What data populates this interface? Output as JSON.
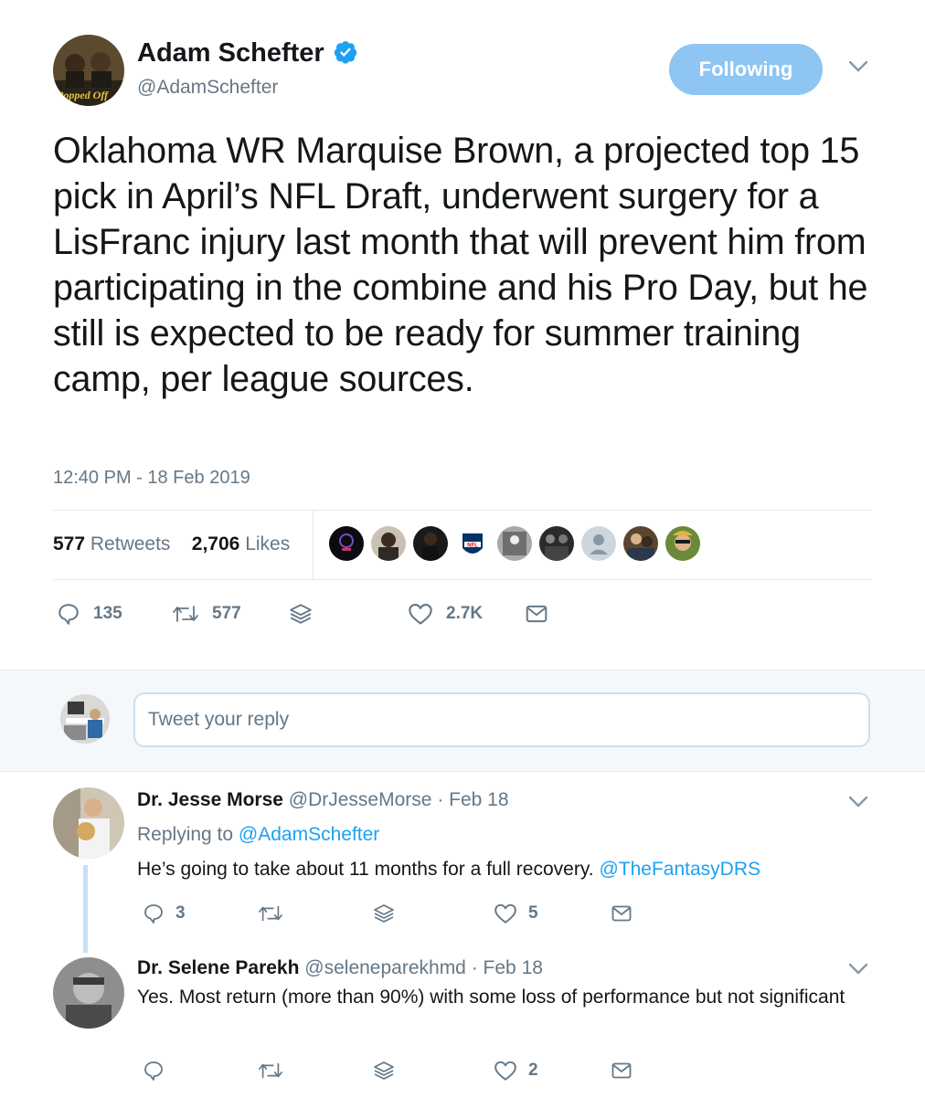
{
  "tweet": {
    "author_name": "Adam Schefter",
    "author_handle": "@AdamSchefter",
    "follow_label": "Following",
    "text": "Oklahoma WR Marquise Brown, a projected top 15 pick in April’s NFL Draft, underwent surgery for a LisFranc injury last month that will prevent him from participating in the combine and his Pro Day, but he still is expected to be ready for summer training camp, per league sources.",
    "timestamp": "12:40 PM - 18 Feb 2019",
    "retweets_count": "577",
    "retweets_label": "Retweets",
    "likes_count": "2,706",
    "likes_label": "Likes",
    "actions": {
      "replies": "135",
      "retweets": "577",
      "likes": "2.7K"
    }
  },
  "composer": {
    "placeholder": "Tweet your reply"
  },
  "replies": [
    {
      "name": "Dr. Jesse Morse",
      "handle": "@DrJesseMorse",
      "date": "· Feb 18",
      "replying_label": "Replying to",
      "replying_to": "@AdamSchefter",
      "text": "He’s going to take about 11 months for a full recovery.",
      "mention": "@TheFantasyDRS",
      "reply_count": "3",
      "like_count": "5"
    },
    {
      "name": "Dr. Selene Parekh",
      "handle": "@seleneparekhmd",
      "date": "· Feb 18",
      "text": "Yes. Most return (more than 90%) with some loss of performance but not significant",
      "like_count": "2"
    }
  ],
  "colors": {
    "accent": "#1da1f2",
    "muted": "#657786",
    "follow_bg": "#8ec5f2"
  }
}
